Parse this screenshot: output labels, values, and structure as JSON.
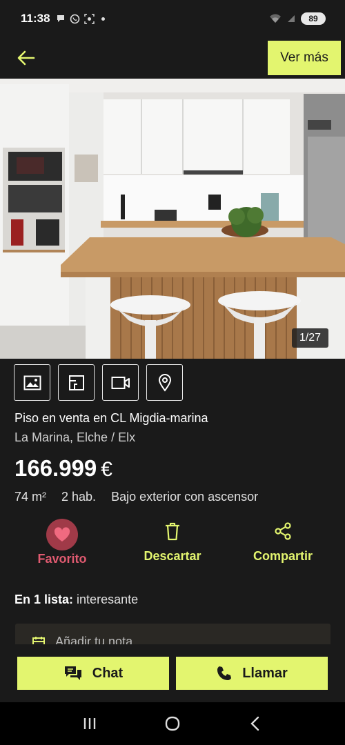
{
  "status_bar": {
    "time": "11:38",
    "notification_icons": [
      "chat-bubble-icon",
      "whatsapp-icon",
      "screenshot-icon",
      "dot-icon"
    ],
    "battery": "89"
  },
  "header": {
    "back_icon": "arrow-left-icon",
    "ver_mas_label": "Ver más"
  },
  "photo": {
    "counter": "1/27"
  },
  "media_tabs": [
    {
      "icon": "image-icon"
    },
    {
      "icon": "floor-plan-icon"
    },
    {
      "icon": "video-icon"
    },
    {
      "icon": "map-pin-icon"
    }
  ],
  "listing": {
    "title": "Piso en venta en CL Migdia-marina",
    "location": "La Marina, Elche / Elx",
    "price": "166.999",
    "currency": "€",
    "area": "74 m²",
    "rooms": "2 hab.",
    "floor": "Bajo exterior con ascensor"
  },
  "actions": {
    "favorite_label": "Favorito",
    "discard_label": "Descartar",
    "share_label": "Compartir"
  },
  "lists": {
    "prefix": "En 1 lista:",
    "value": "interesante"
  },
  "note": {
    "label": "Añadir tu nota"
  },
  "cta": {
    "chat_label": "Chat",
    "call_label": "Llamar"
  },
  "colors": {
    "accent": "#e3f56f",
    "background": "#1a1a1a",
    "favorite": "#e05a70"
  }
}
